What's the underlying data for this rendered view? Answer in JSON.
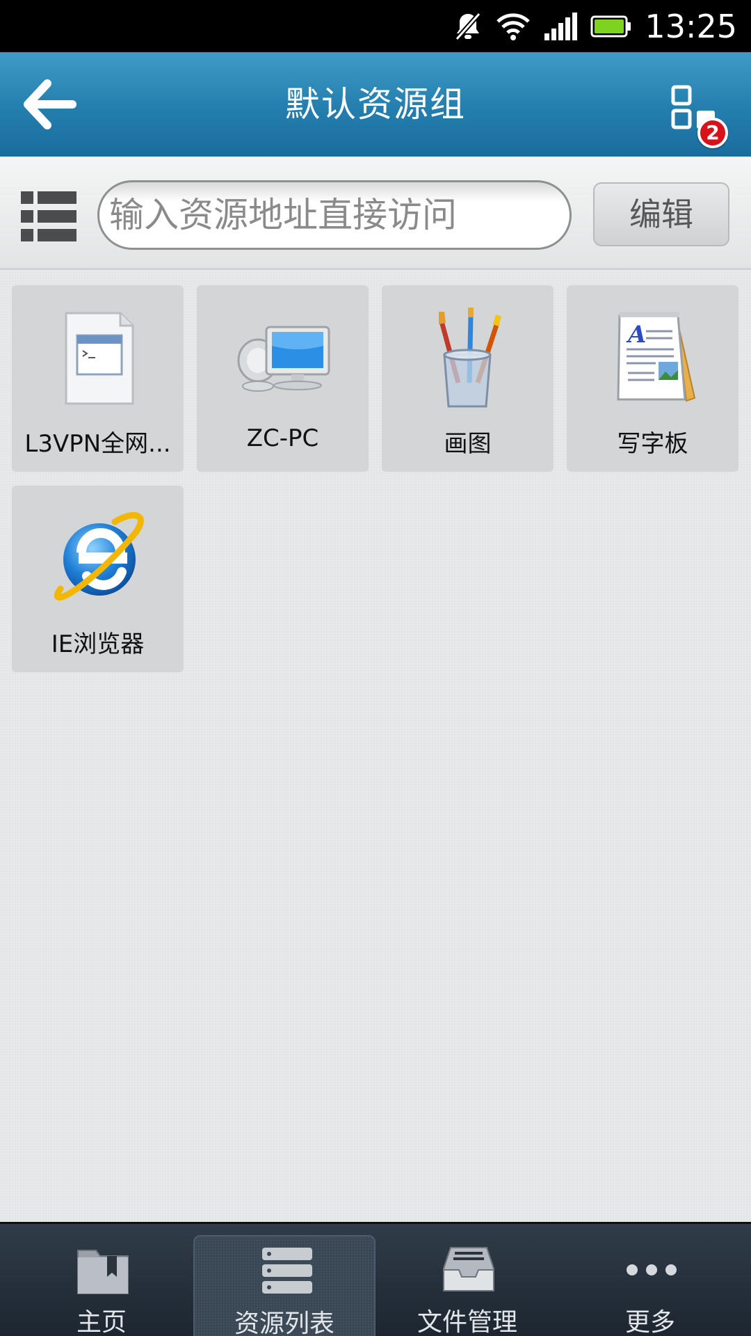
{
  "status_bar": {
    "time": "13:25",
    "icons": [
      "mute-icon",
      "wifi-icon",
      "signal-icon",
      "battery-icon"
    ]
  },
  "header": {
    "title": "默认资源组",
    "badge_count": "2",
    "icons": [
      "back-arrow-icon",
      "apps-grid-icon"
    ]
  },
  "search": {
    "placeholder": "输入资源地址直接访问",
    "value": "",
    "edit_label": "编辑"
  },
  "resources": [
    {
      "label": "L3VPN全网...",
      "icon": "application-window-icon"
    },
    {
      "label": "ZC-PC",
      "icon": "computer-icon"
    },
    {
      "label": "画图",
      "icon": "paint-brushes-icon"
    },
    {
      "label": "写字板",
      "icon": "wordpad-icon"
    },
    {
      "label": "IE浏览器",
      "icon": "ie-browser-icon"
    }
  ],
  "tabs": [
    {
      "label": "主页",
      "icon": "bookmark-folder-icon",
      "active": false
    },
    {
      "label": "资源列表",
      "icon": "server-list-icon",
      "active": true
    },
    {
      "label": "文件管理",
      "icon": "file-tray-icon",
      "active": false
    },
    {
      "label": "更多",
      "icon": "more-dots-icon",
      "active": false
    }
  ],
  "colors": {
    "header": "#237eae",
    "badge": "#d7121b",
    "tab_bar": "#1d2630",
    "content_bg": "#e6e8e9"
  }
}
